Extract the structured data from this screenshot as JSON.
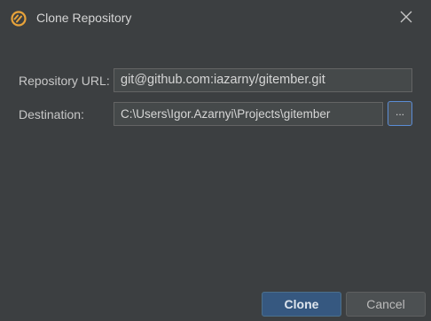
{
  "window": {
    "title": "Clone Repository",
    "logo_icon": "gitember-logo-icon",
    "close_icon": "close-icon"
  },
  "form": {
    "repository_url": {
      "label": "Repository URL:",
      "value": "git@github.com:iazarny/gitember.git"
    },
    "destination": {
      "label": "Destination:",
      "value": "C:\\Users\\Igor.Azarnyi\\Projects\\gitember",
      "browse_label": "..."
    }
  },
  "buttons": {
    "clone_label": "Clone",
    "cancel_label": "Cancel"
  },
  "colors": {
    "background": "#3c3f41",
    "input_background": "#45494a",
    "primary_button": "#365880",
    "focus_border": "#5b8dd6",
    "logo": "#e8a33a"
  }
}
